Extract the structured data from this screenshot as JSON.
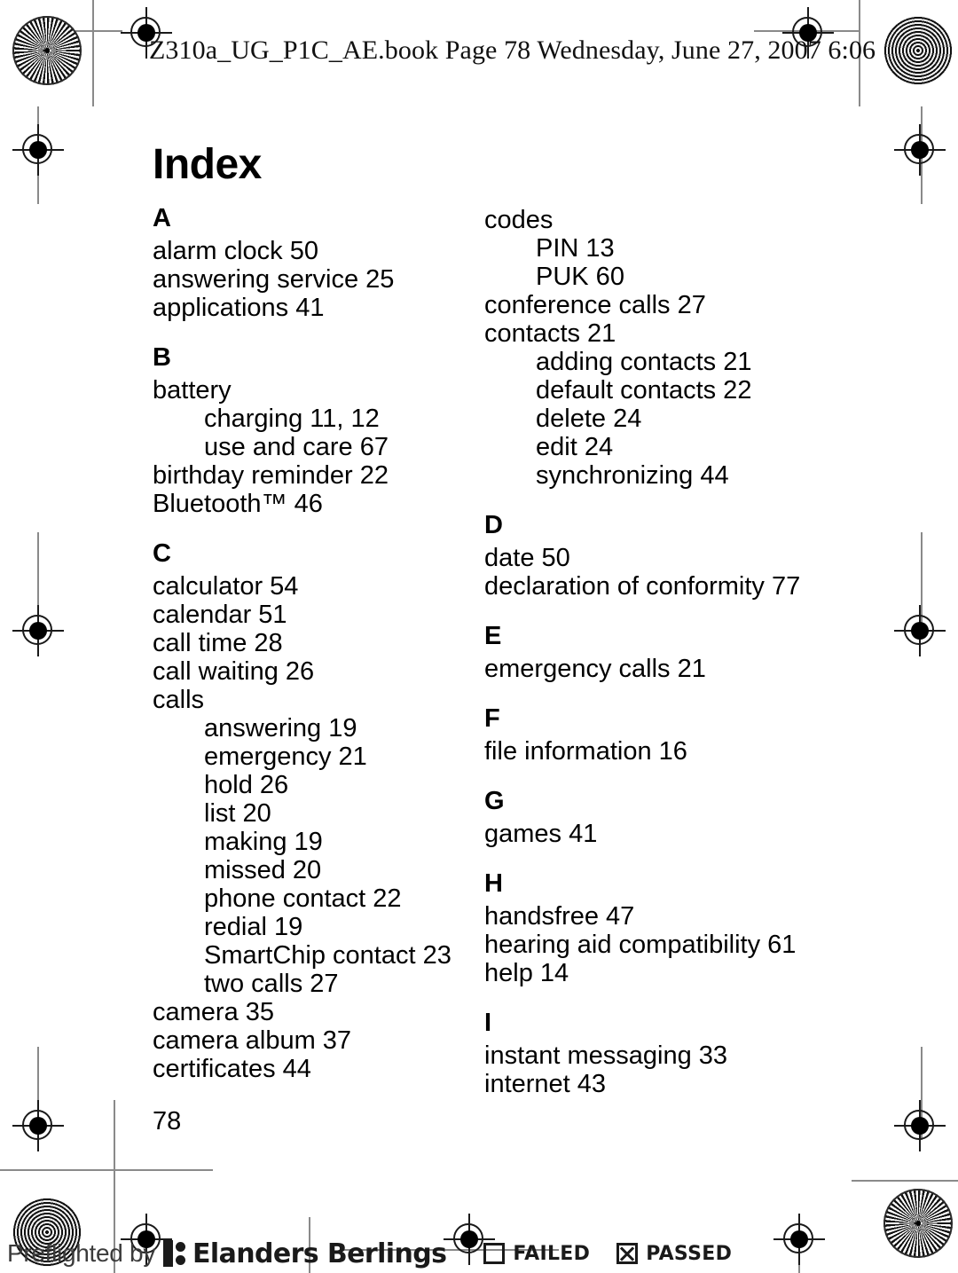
{
  "header": {
    "slug": "Z310a_UG_P1C_AE.book  Page 78  Wednesday, June 27, 2007  6:06"
  },
  "page": {
    "title": "Index",
    "folio": "78"
  },
  "left_column": [
    {
      "letter": "A",
      "entries": [
        {
          "text": "alarm clock 50",
          "sub": false
        },
        {
          "text": "answering service 25",
          "sub": false
        },
        {
          "text": "applications 41",
          "sub": false
        }
      ]
    },
    {
      "letter": "B",
      "entries": [
        {
          "text": "battery",
          "sub": false
        },
        {
          "text": "charging 11, 12",
          "sub": true
        },
        {
          "text": "use and care 67",
          "sub": true
        },
        {
          "text": "birthday reminder 22",
          "sub": false
        },
        {
          "text": "Bluetooth™ 46",
          "sub": false
        }
      ]
    },
    {
      "letter": "C",
      "entries": [
        {
          "text": "calculator 54",
          "sub": false
        },
        {
          "text": "calendar 51",
          "sub": false
        },
        {
          "text": "call time 28",
          "sub": false
        },
        {
          "text": "call waiting 26",
          "sub": false
        },
        {
          "text": "calls",
          "sub": false
        },
        {
          "text": "answering 19",
          "sub": true
        },
        {
          "text": "emergency 21",
          "sub": true
        },
        {
          "text": "hold 26",
          "sub": true
        },
        {
          "text": "list 20",
          "sub": true
        },
        {
          "text": "making 19",
          "sub": true
        },
        {
          "text": "missed 20",
          "sub": true
        },
        {
          "text": "phone contact 22",
          "sub": true
        },
        {
          "text": "redial 19",
          "sub": true
        },
        {
          "text": "SmartChip contact 23",
          "sub": true
        },
        {
          "text": "two calls 27",
          "sub": true
        },
        {
          "text": "camera 35",
          "sub": false
        },
        {
          "text": "camera album 37",
          "sub": false
        },
        {
          "text": "certificates 44",
          "sub": false
        }
      ]
    }
  ],
  "right_column": [
    {
      "letter": "",
      "entries": [
        {
          "text": "codes",
          "sub": false
        },
        {
          "text": "PIN 13",
          "sub": true
        },
        {
          "text": "PUK 60",
          "sub": true
        },
        {
          "text": "conference calls 27",
          "sub": false
        },
        {
          "text": "contacts 21",
          "sub": false
        },
        {
          "text": "adding contacts 21",
          "sub": true
        },
        {
          "text": "default contacts 22",
          "sub": true
        },
        {
          "text": "delete 24",
          "sub": true
        },
        {
          "text": "edit 24",
          "sub": true
        },
        {
          "text": "synchronizing 44",
          "sub": true
        }
      ]
    },
    {
      "letter": "D",
      "entries": [
        {
          "text": "date 50",
          "sub": false
        },
        {
          "text": "declaration of conformity 77",
          "sub": false
        }
      ]
    },
    {
      "letter": "E",
      "entries": [
        {
          "text": "emergency calls 21",
          "sub": false
        }
      ]
    },
    {
      "letter": "F",
      "entries": [
        {
          "text": "file information 16",
          "sub": false
        }
      ]
    },
    {
      "letter": "G",
      "entries": [
        {
          "text": "games 41",
          "sub": false
        }
      ]
    },
    {
      "letter": "H",
      "entries": [
        {
          "text": "handsfree 47",
          "sub": false
        },
        {
          "text": "hearing aid compatibility 61",
          "sub": false
        },
        {
          "text": "help 14",
          "sub": false
        }
      ]
    },
    {
      "letter": "I",
      "entries": [
        {
          "text": "instant messaging 33",
          "sub": false
        },
        {
          "text": "internet 43",
          "sub": false
        }
      ]
    }
  ],
  "preflight": {
    "prefix": "Preflighted by",
    "brand": "Elanders Berlings",
    "failed_label": "FAILED",
    "passed_label": "PASSED",
    "failed_checked": false,
    "passed_checked": true
  },
  "colors": {
    "ink": "#000000",
    "rule": "#8a8a8a",
    "mark": "#1a1a1a"
  }
}
